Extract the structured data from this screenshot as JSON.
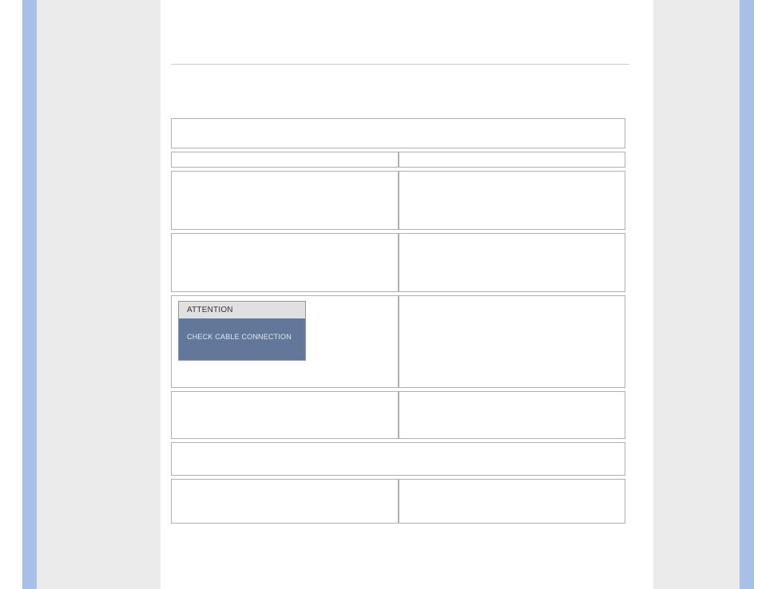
{
  "dialog": {
    "title": "ATTENTION",
    "body": "CHECK CABLE CONNECTION"
  }
}
